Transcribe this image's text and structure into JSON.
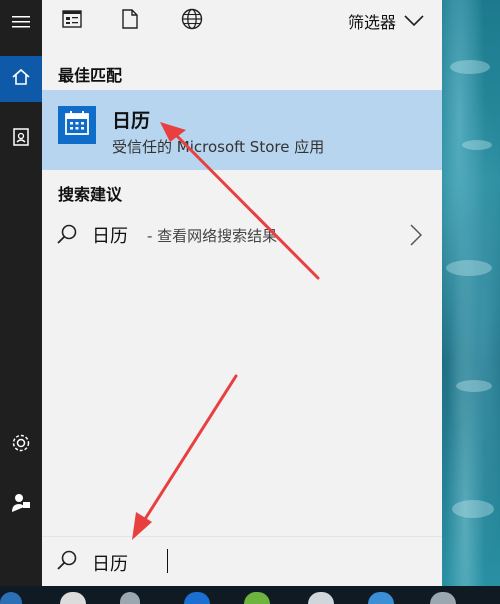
{
  "toolbar": {
    "filter_label": "筛选器",
    "icons": [
      "apps-icon",
      "documents-icon",
      "web-icon",
      "chevron-down-icon"
    ]
  },
  "rail": {
    "icons": [
      "hamburger-menu-icon",
      "home-icon",
      "notebook-icon",
      "settings-icon",
      "feedback-icon"
    ]
  },
  "best_match": {
    "section_title": "最佳匹配",
    "app_name": "日历",
    "app_subtitle": "受信任的 Microsoft Store 应用"
  },
  "suggestions": {
    "section_title": "搜索建议",
    "items": [
      {
        "main": "日历",
        "tail": " - 查看网络搜索结果"
      }
    ]
  },
  "search": {
    "value": "日历"
  },
  "colors": {
    "highlight": "#b7d5ee",
    "accent": "#0f5aa8",
    "annotation": "#e8403f"
  }
}
